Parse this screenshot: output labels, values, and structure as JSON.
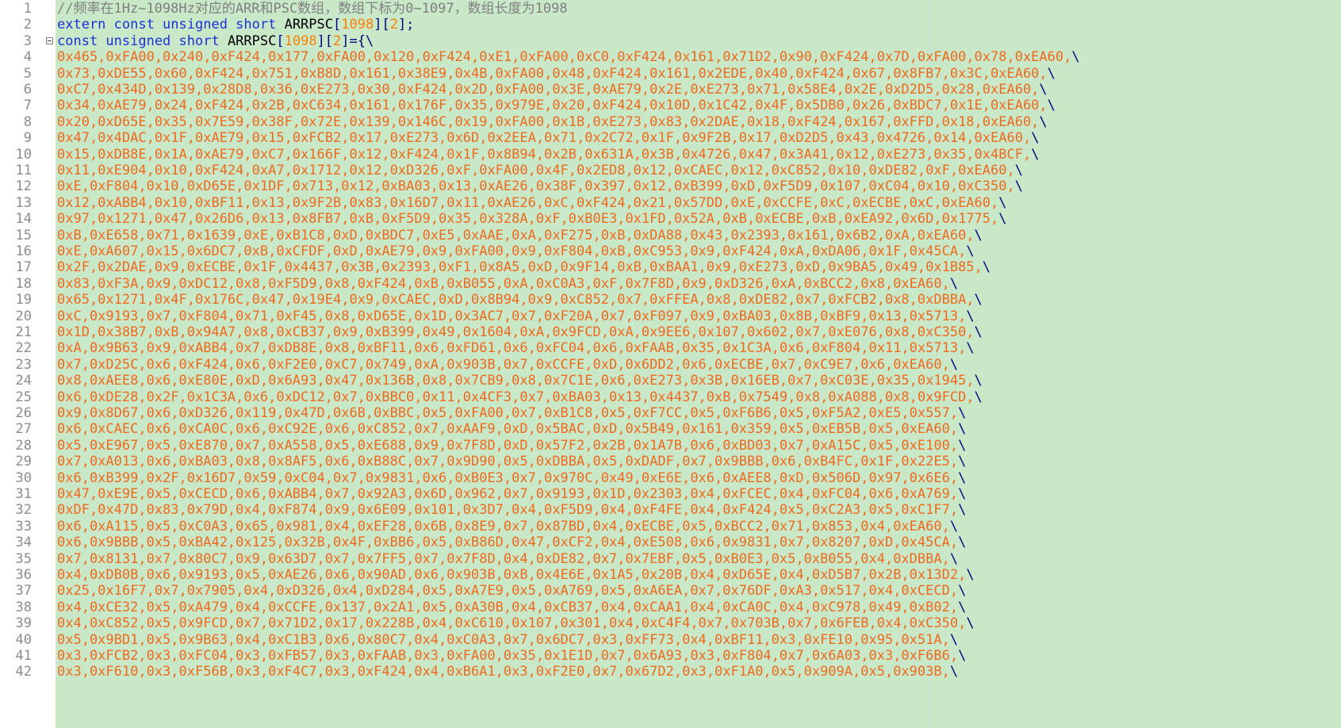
{
  "editor": {
    "line_numbers": [
      "1",
      "2",
      "3",
      "4",
      "5",
      "6",
      "7",
      "8",
      "9",
      "10",
      "11",
      "12",
      "13",
      "14",
      "15",
      "16",
      "17",
      "18",
      "19",
      "20",
      "21",
      "22",
      "23",
      "24",
      "25",
      "26",
      "27",
      "28",
      "29",
      "30",
      "31",
      "32",
      "33",
      "34",
      "35",
      "36",
      "37",
      "38",
      "39",
      "40",
      "41",
      "42"
    ],
    "comment_line": "//频率在1Hz~1098Hz对应的ARR和PSC数组，数组下标为0~1097，数组长度为1098",
    "extern_line": {
      "kw1": "extern const unsigned short ",
      "ident": "ARRPSC",
      "b1open": "[",
      "num1": "1098",
      "b1close": "][",
      "num2": "2",
      "tail": "];"
    },
    "decl_line": {
      "kw1": "const unsigned short ",
      "ident": "ARRPSC",
      "b1open": "[",
      "num1": "1098",
      "b1close": "][",
      "num2": "2",
      "tail": "]={\\"
    },
    "data_lines": [
      "0x465,0xFA00,0x240,0xF424,0x177,0xFA00,0x120,0xF424,0xE1,0xFA00,0xC0,0xF424,0x161,0x71D2,0x90,0xF424,0x7D,0xFA00,0x78,0xEA60,",
      "0x73,0xDE55,0x60,0xF424,0x751,0xB8D,0x161,0x38E9,0x4B,0xFA00,0x48,0xF424,0x161,0x2EDE,0x40,0xF424,0x67,0x8FB7,0x3C,0xEA60,",
      "0xC7,0x434D,0x139,0x28D8,0x36,0xE273,0x30,0xF424,0x2D,0xFA00,0x3E,0xAE79,0x2E,0xE273,0x71,0x58E4,0x2E,0xD2D5,0x28,0xEA60,",
      "0x34,0xAE79,0x24,0xF424,0x2B,0xC634,0x161,0x176F,0x35,0x979E,0x20,0xF424,0x10D,0x1C42,0x4F,0x5DB0,0x26,0xBDC7,0x1E,0xEA60,",
      "0x20,0xD65E,0x35,0x7E59,0x38F,0x72E,0x139,0x146C,0x19,0xFA00,0x1B,0xE273,0x83,0x2DAE,0x18,0xF424,0x167,0xFFD,0x18,0xEA60,",
      "0x47,0x4DAC,0x1F,0xAE79,0x15,0xFCB2,0x17,0xE273,0x6D,0x2EEA,0x71,0x2C72,0x1F,0x9F2B,0x17,0xD2D5,0x43,0x4726,0x14,0xEA60,",
      "0x15,0xDB8E,0x1A,0xAE79,0xC7,0x166F,0x12,0xF424,0x1F,0x8B94,0x2B,0x631A,0x3B,0x4726,0x47,0x3A41,0x12,0xE273,0x35,0x4BCF,",
      "0x11,0xE904,0x10,0xF424,0xA7,0x1712,0x12,0xD326,0xF,0xFA00,0x4F,0x2ED8,0x12,0xCAEC,0x12,0xC852,0x10,0xDE82,0xF,0xEA60,",
      "0xE,0xF804,0x10,0xD65E,0x1DF,0x713,0x12,0xBA03,0x13,0xAE26,0x38F,0x397,0x12,0xB399,0xD,0xF5D9,0x107,0xC04,0x10,0xC350,",
      "0x12,0xABB4,0x10,0xBF11,0x13,0x9F2B,0x83,0x16D7,0x11,0xAE26,0xC,0xF424,0x21,0x57DD,0xE,0xCCFE,0xC,0xECBE,0xC,0xEA60,",
      "0x97,0x1271,0x47,0x26D6,0x13,0x8FB7,0xB,0xF5D9,0x35,0x328A,0xF,0xB0E3,0x1FD,0x52A,0xB,0xECBE,0xB,0xEA92,0x6D,0x1775,",
      "0xB,0xE658,0x71,0x1639,0xE,0xB1C8,0xD,0xBDC7,0xE5,0xAAE,0xA,0xF275,0xB,0xDA88,0x43,0x2393,0x161,0x6B2,0xA,0xEA60,",
      "0xE,0xA607,0x15,0x6DC7,0xB,0xCFDF,0xD,0xAE79,0x9,0xFA00,0x9,0xF804,0xB,0xC953,0x9,0xF424,0xA,0xDA06,0x1F,0x45CA,",
      "0x2F,0x2DAE,0x9,0xECBE,0x1F,0x4437,0x3B,0x2393,0xF1,0x8A5,0xD,0x9F14,0xB,0xBAA1,0x9,0xE273,0xD,0x9BA5,0x49,0x1B85,",
      "0x83,0xF3A,0x9,0xDC12,0x8,0xF5D9,0x8,0xF424,0xB,0xB055,0xA,0xC0A3,0xF,0x7F8D,0x9,0xD326,0xA,0xBCC2,0x8,0xEA60,",
      "0x65,0x1271,0x4F,0x176C,0x47,0x19E4,0x9,0xCAEC,0xD,0x8B94,0x9,0xC852,0x7,0xFFEA,0x8,0xDE82,0x7,0xFCB2,0x8,0xDBBA,",
      "0xC,0x9193,0x7,0xF804,0x71,0xF45,0x8,0xD65E,0x1D,0x3AC7,0x7,0xF20A,0x7,0xF097,0x9,0xBA03,0x8B,0xBF9,0x13,0x5713,",
      "0x1D,0x38B7,0xB,0x94A7,0x8,0xCB37,0x9,0xB399,0x49,0x1604,0xA,0x9FCD,0xA,0x9EE6,0x107,0x602,0x7,0xE076,0x8,0xC350,",
      "0xA,0x9B63,0x9,0xABB4,0x7,0xDB8E,0x8,0xBF11,0x6,0xFD61,0x6,0xFC04,0x6,0xFAAB,0x35,0x1C3A,0x6,0xF804,0x11,0x5713,",
      "0x7,0xD25C,0x6,0xF424,0x6,0xF2E0,0xC7,0x749,0xA,0x903B,0x7,0xCCFE,0xD,0x6DD2,0x6,0xECBE,0x7,0xC9E7,0x6,0xEA60,",
      "0x8,0xAEE8,0x6,0xE80E,0xD,0x6A93,0x47,0x136B,0x8,0x7CB9,0x8,0x7C1E,0x6,0xE273,0x3B,0x16EB,0x7,0xC03E,0x35,0x1945,",
      "0x6,0xDE28,0x2F,0x1C3A,0x6,0xDC12,0x7,0xBBC0,0x11,0x4CF3,0x7,0xBA03,0x13,0x4437,0xB,0x7549,0x8,0xA088,0x8,0x9FCD,",
      "0x9,0x8D67,0x6,0xD326,0x119,0x47D,0x6B,0xBBC,0x5,0xFA00,0x7,0xB1C8,0x5,0xF7CC,0x5,0xF6B6,0x5,0xF5A2,0xE5,0x557,",
      "0x6,0xCAEC,0x6,0xCA0C,0x6,0xC92E,0x6,0xC852,0x7,0xAAF9,0xD,0x5BAC,0xD,0x5B49,0x161,0x359,0x5,0xEB5B,0x5,0xEA60,",
      "0x5,0xE967,0x5,0xE870,0x7,0xA558,0x5,0xE688,0x9,0x7F8D,0xD,0x57F2,0x2B,0x1A7B,0x6,0xBD03,0x7,0xA15C,0x5,0xE100,",
      "0x7,0xA013,0x6,0xBA03,0x8,0x8AF5,0x6,0xB88C,0x7,0x9D90,0x5,0xDBBA,0x5,0xDADF,0x7,0x9BBB,0x6,0xB4FC,0x1F,0x22E5,",
      "0x6,0xB399,0x2F,0x16D7,0x59,0xC04,0x7,0x9831,0x6,0xB0E3,0x7,0x970C,0x49,0xE6E,0x6,0xAEE8,0xD,0x506D,0x97,0x6E6,",
      "0x47,0xE9E,0x5,0xCECD,0x6,0xABB4,0x7,0x92A3,0x6D,0x962,0x7,0x9193,0x1D,0x2303,0x4,0xFCEC,0x4,0xFC04,0x6,0xA769,",
      "0xDF,0x47D,0x83,0x79D,0x4,0xF874,0x9,0x6E09,0x101,0x3D7,0x4,0xF5D9,0x4,0xF4FE,0x4,0xF424,0x5,0xC2A3,0x5,0xC1F7,",
      "0x6,0xA115,0x5,0xC0A3,0x65,0x981,0x4,0xEF28,0x6B,0x8E9,0x7,0x87BD,0x4,0xECBE,0x5,0xBCC2,0x71,0x853,0x4,0xEA60,",
      "0x6,0x9BBB,0x5,0xBA42,0x125,0x32B,0x4F,0xBB6,0x5,0xB86D,0x47,0xCF2,0x4,0xE508,0x6,0x9831,0x7,0x8207,0xD,0x45CA,",
      "0x7,0x8131,0x7,0x80C7,0x9,0x63D7,0x7,0x7FF5,0x7,0x7F8D,0x4,0xDE82,0x7,0x7EBF,0x5,0xB0E3,0x5,0xB055,0x4,0xDBBA,",
      "0x4,0xDB0B,0x6,0x9193,0x5,0xAE26,0x6,0x90AD,0x6,0x903B,0xB,0x4E6E,0x1A5,0x20B,0x4,0xD65E,0x4,0xD5B7,0x2B,0x13D2,",
      "0x25,0x16F7,0x7,0x7905,0x4,0xD326,0x4,0xD284,0x5,0xA7E9,0x5,0xA769,0x5,0xA6EA,0x7,0x76DF,0xA3,0x517,0x4,0xCECD,",
      "0x4,0xCE32,0x5,0xA479,0x4,0xCCFE,0x137,0x2A1,0x5,0xA30B,0x4,0xCB37,0x4,0xCAA1,0x4,0xCA0C,0x4,0xC978,0x49,0xB02,",
      "0x4,0xC852,0x5,0x9FCD,0x7,0x71D2,0x17,0x228B,0x4,0xC610,0x107,0x301,0x4,0xC4F4,0x7,0x703B,0x7,0x6FEB,0x4,0xC350,",
      "0x5,0x9BD1,0x5,0x9B63,0x4,0xC1B3,0x6,0x80C7,0x4,0xC0A3,0x7,0x6DC7,0x3,0xFF73,0x4,0xBF11,0x3,0xFE10,0x95,0x51A,",
      "0x3,0xFCB2,0x3,0xFC04,0x3,0xFB57,0x3,0xFAAB,0x3,0xFA00,0x35,0x1E1D,0x7,0x6A93,0x3,0xF804,0x7,0x6A03,0x3,0xF6B6,",
      "0x3,0xF610,0x3,0xF56B,0x3,0xF4C7,0x3,0xF424,0x4,0xB6A1,0x3,0xF2E0,0x7,0x67D2,0x3,0xF1A0,0x5,0x909A,0x5,0x903B,"
    ],
    "line_continuation": "\\"
  },
  "colors": {
    "code_background": "#c8e8c8",
    "comment": "#7f7f7f",
    "keyword": "#1e2fd8",
    "number": "#ff8000",
    "data": "#ef6a1f",
    "line_number": "#8c8c8c"
  }
}
